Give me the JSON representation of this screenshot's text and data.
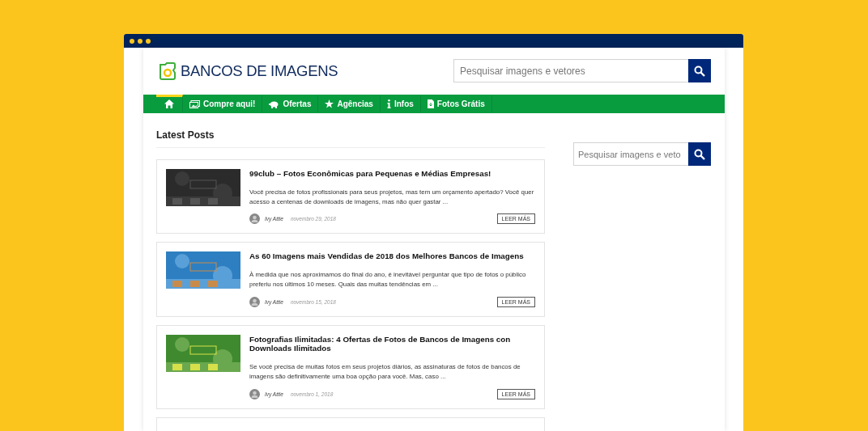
{
  "logo": {
    "text": "BANCOS DE IMAGENS"
  },
  "header_search": {
    "placeholder": "Pesquisar imagens e vetores"
  },
  "nav": [
    {
      "kind": "home",
      "selected": true
    },
    {
      "kind": "cart",
      "label": "Compre aqui!",
      "selected": false
    },
    {
      "kind": "piggy",
      "label": "Ofertas",
      "selected": false
    },
    {
      "kind": "star",
      "label": "Agências",
      "selected": false
    },
    {
      "kind": "info",
      "label": "Infos",
      "selected": false
    },
    {
      "kind": "file",
      "label": "Fotos Grátis",
      "selected": false
    }
  ],
  "section_title": "Latest Posts",
  "posts": [
    {
      "kind": "picture",
      "title": "99club – Fotos Econômicas para Pequenas e Médias Empresas!",
      "excerpt": "Você precisa de fotos profissionais para seus projetos, mas tem um orçamento apertado? Você quer acesso a centenas de downloads de imagens, mas não quer gastar ...",
      "author": "Ivy Attie",
      "date": "novembro 29, 2018",
      "button": "LEER MÁS"
    },
    {
      "kind": "picture",
      "title": "As 60 Imagens mais Vendidas de 2018 dos Melhores Bancos de Imagens",
      "excerpt": "À medida que nos aproximamos do final do ano, é inevitável perguntar que tipo de fotos o público preferiu nos últimos 10 meses. Quais das muitas tendências em ...",
      "author": "Ivy Attie",
      "date": "novembro 15, 2018",
      "button": "LEER MÁS"
    },
    {
      "kind": "picture",
      "title": "Fotografias Ilimitadas: 4 Ofertas de Fotos de Bancos de Imagens con Downloads Ilimitados",
      "excerpt": "Se você precisa de muitas fotos em seus projetos diários, as assinaturas de fotos de bancos de imagens são definitivamente uma boa opção para você. Mas, caso ...",
      "author": "Ivy Attie",
      "date": "novembro 1, 2018",
      "button": "LEER MÁS"
    }
  ],
  "sidebar_search": {
    "placeholder": "Pesquisar imagens e veto"
  }
}
